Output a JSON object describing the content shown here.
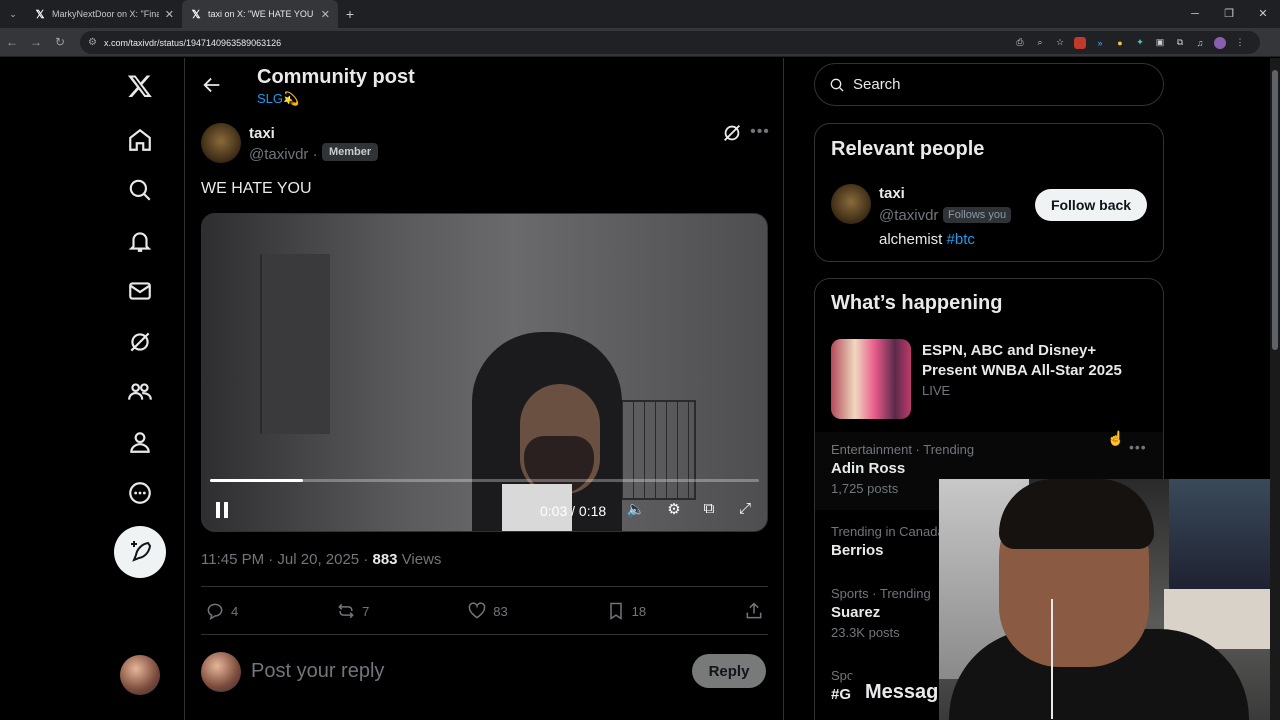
{
  "browser": {
    "tabs": [
      {
        "title": "MarkyNextDoor on X: \"Finally a",
        "active": false
      },
      {
        "title": "taxi on X: \"WE HATE YOU h",
        "active": true
      }
    ],
    "url": "x.com/taxivdr/status/1947140963589063126",
    "new_tab": "+"
  },
  "header": {
    "title": "Community post",
    "subtitle": "SLG💫"
  },
  "tweet": {
    "author_name": "taxi",
    "author_handle": "@taxivdr ·",
    "badge": "Member",
    "text": "WE HATE YOU",
    "video": {
      "timecode": "0:03 / 0:18",
      "progress": 0.17
    },
    "time": "11:45 PM · Jul 20, 2025 · ",
    "views_count": "883",
    "views_label": " Views",
    "replies": "4",
    "reposts": "7",
    "likes": "83",
    "bookmarks": "18"
  },
  "reply_box": {
    "placeholder": "Post your reply",
    "button": "Reply"
  },
  "search": {
    "placeholder": "Search"
  },
  "relevant_people": {
    "title": "Relevant people",
    "name": "taxi",
    "handle": "@taxivdr",
    "follows_you": "Follows you",
    "bio_text": "alchemist ",
    "bio_tag": "#btc",
    "follow_button": "Follow back"
  },
  "whats_happening": {
    "title": "What’s happening",
    "live_title": "ESPN, ABC and Disney+ Present WNBA All-Star 2025",
    "live_tag": "LIVE",
    "trends": [
      {
        "context": "Entertainment · Trending",
        "name": "Adin Ross",
        "count": "1,725 posts"
      },
      {
        "context": "Trending in Canada",
        "name": "Berrios",
        "count": ""
      },
      {
        "context": "Sports · Trending",
        "name": "Suarez",
        "count": "23.3K posts"
      },
      {
        "context": "Spo",
        "name": "#G",
        "count": ""
      }
    ]
  },
  "messages": {
    "label": "Messages"
  },
  "colors": {
    "accent": "#1d9bf0",
    "background": "#000000",
    "border": "#2f3336"
  }
}
